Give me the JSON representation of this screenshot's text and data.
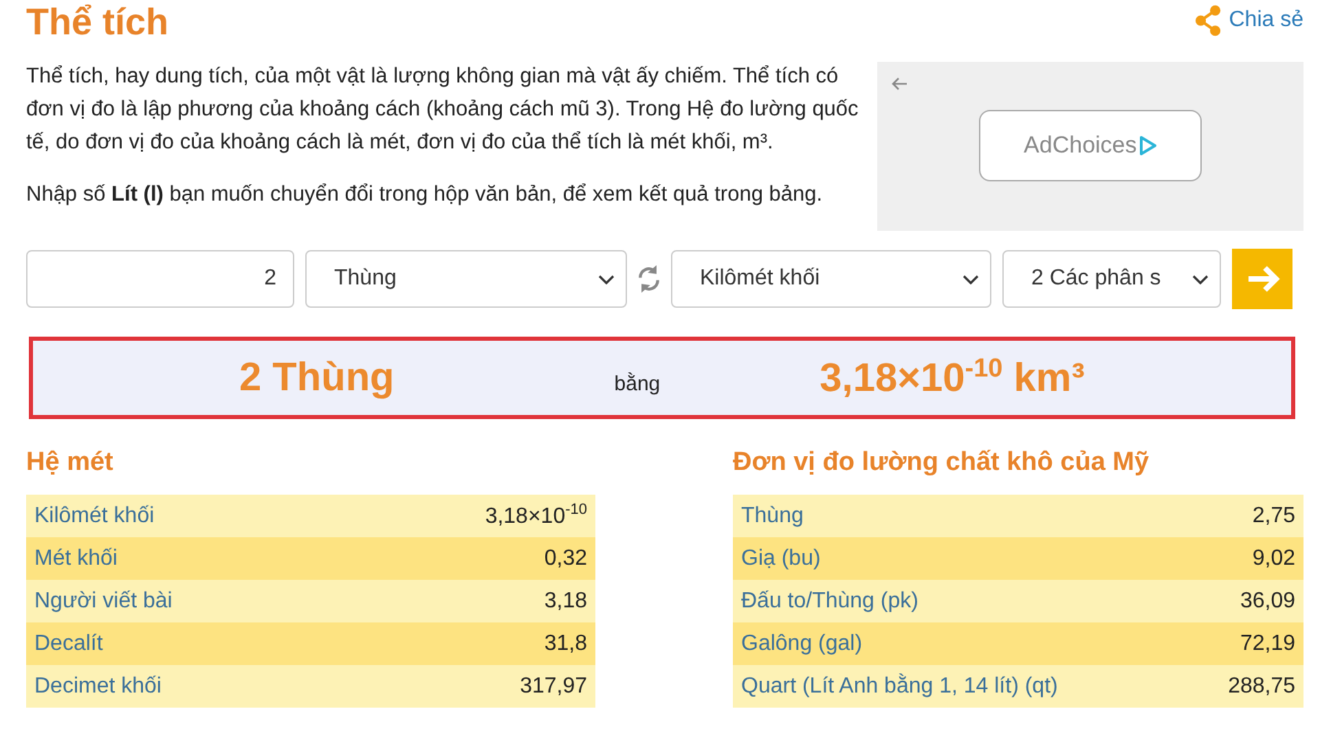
{
  "title": "Thể tích",
  "share": {
    "label": "Chia sẻ"
  },
  "intro": "Thể tích, hay dung tích, của một vật là lượng không gian mà vật ấy chiếm. Thể tích có đơn vị đo là lập phương của khoảng cách (khoảng cách mũ 3). Trong Hệ đo lường quốc tế, do đơn vị đo của khoảng cách là mét, đơn vị đo của thể tích là mét khối, m³.",
  "instruction": "Nhập số **Lít (l)** bạn muốn chuyển đổi trong hộp văn bản, để xem kết quả trong bảng.",
  "ad": {
    "label": "AdChoices"
  },
  "converter": {
    "value": "2",
    "from_unit": "Thùng",
    "to_unit": "Kilômét khối",
    "precision": "2 Các phân s"
  },
  "result": {
    "from": "2 Thùng",
    "equals": "bằng",
    "to": "3,18×10$^{-10}$ km³"
  },
  "tables": [
    {
      "title": "Hệ mét",
      "rows": [
        {
          "unit": "Kilômét khối",
          "value": "3,18×10$^{-10}$"
        },
        {
          "unit": "Mét khối",
          "value": "0,32"
        },
        {
          "unit": "Người viết bài",
          "value": "3,18"
        },
        {
          "unit": "Decalít",
          "value": "31,8"
        },
        {
          "unit": "Decimet khối",
          "value": "317,97"
        }
      ]
    },
    {
      "title": "Đơn vị đo lường chất khô của Mỹ",
      "rows": [
        {
          "unit": "Thùng",
          "value": "2,75"
        },
        {
          "unit": "Giạ (bu)",
          "value": "9,02"
        },
        {
          "unit": "Đấu to/Thùng (pk)",
          "value": "36,09"
        },
        {
          "unit": "Galông (gal)",
          "value": "72,19"
        },
        {
          "unit": "Quart (Lít Anh bằng 1, 14 lít) (qt)",
          "value": "288,75"
        }
      ]
    }
  ]
}
